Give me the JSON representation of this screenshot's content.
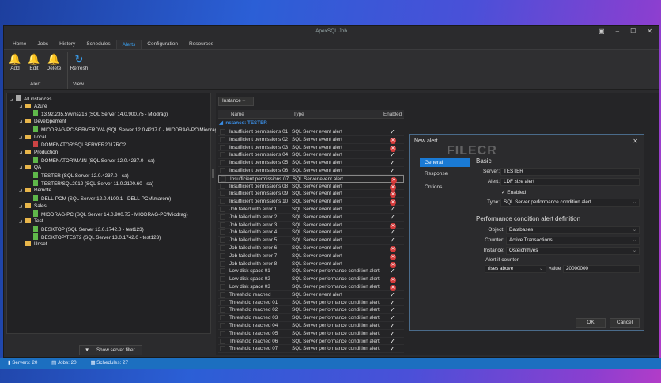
{
  "window": {
    "title": "ApexSQL Job"
  },
  "menu": [
    "Home",
    "Jobs",
    "History",
    "Schedules",
    "Alerts",
    "Configuration",
    "Resources"
  ],
  "ribbon": {
    "add": "Add",
    "edit": "Edit",
    "delete": "Delete",
    "refresh": "Refresh",
    "group_alert": "Alert",
    "group_view": "View"
  },
  "tree": [
    {
      "level": 0,
      "kind": "root",
      "label": "All instances"
    },
    {
      "level": 1,
      "kind": "folder",
      "label": "Azure"
    },
    {
      "level": 2,
      "kind": "server",
      "label": "13.92.235.5\\wins216 (SQL Server 14.0.900.75 - Miodrag)"
    },
    {
      "level": 1,
      "kind": "folder",
      "label": "Developement"
    },
    {
      "level": 2,
      "kind": "server",
      "label": "MIODRAG-PC\\SERVERDVA (SQL Server 12.0.4237.0 - MIODRAG-PC\\Miodrag)"
    },
    {
      "level": 1,
      "kind": "folder",
      "label": "Local"
    },
    {
      "level": 2,
      "kind": "server-error",
      "label": "DOMENATOR\\SQLSERVER2017RC2"
    },
    {
      "level": 1,
      "kind": "folder",
      "label": "Production"
    },
    {
      "level": 2,
      "kind": "server",
      "label": "DOMENATOR\\MAIN (SQL Server 12.0.4237.0 - sa)"
    },
    {
      "level": 1,
      "kind": "folder",
      "label": "QA"
    },
    {
      "level": 2,
      "kind": "server",
      "label": "TESTER (SQL Server 12.0.4237.0 - sa)"
    },
    {
      "level": 2,
      "kind": "server",
      "label": "TESTER\\SQL2012 (SQL Server 11.0.2100.60 - sa)"
    },
    {
      "level": 1,
      "kind": "folder",
      "label": "Remote"
    },
    {
      "level": 2,
      "kind": "server",
      "label": "DELL-PCM (SQL Server 12.0.4100.1 - DELL-PCM\\marem)"
    },
    {
      "level": 1,
      "kind": "folder",
      "label": "Sales"
    },
    {
      "level": 2,
      "kind": "server",
      "label": "MIODRAG-PC (SQL Server 14.0.900.75 - MIODRAG-PC\\Miodrag)"
    },
    {
      "level": 1,
      "kind": "folder",
      "label": "Test"
    },
    {
      "level": 2,
      "kind": "server",
      "label": "DESKTOP (SQL Server 13.0.1742.0 - test123)"
    },
    {
      "level": 2,
      "kind": "server",
      "label": "DESKTOP\\TEST2 (SQL Server 13.0.1742.0 - test123)"
    },
    {
      "level": 1,
      "kind": "folder-noexp",
      "label": "Unset"
    }
  ],
  "filter_button": "Show server filter",
  "grid": {
    "group_by": "Instance",
    "columns": [
      "Name",
      "Type",
      "Enabled"
    ],
    "group": "Instance: TESTER",
    "rows": [
      [
        "Insufficient permissions 01",
        "SQL Server event alert",
        true
      ],
      [
        "Insufficient permissions 02",
        "SQL Server event alert",
        false
      ],
      [
        "Insufficient permissions 03",
        "SQL Server event alert",
        false
      ],
      [
        "Insufficient permissions 04",
        "SQL Server event alert",
        true
      ],
      [
        "Insufficient permissions 05",
        "SQL Server event alert",
        true
      ],
      [
        "Insufficient permissions 06",
        "SQL Server event alert",
        true
      ],
      [
        "Insufficient permissions 07",
        "SQL Server event alert",
        false
      ],
      [
        "Insufficient permissions 08",
        "SQL Server event alert",
        false
      ],
      [
        "Insufficient permissions 09",
        "SQL Server event alert",
        false
      ],
      [
        "Insufficient permissions 10",
        "SQL Server event alert",
        false
      ],
      [
        "Job failed with error 1",
        "SQL Server event alert",
        true
      ],
      [
        "Job failed with error 2",
        "SQL Server event alert",
        true
      ],
      [
        "Job failed with error 3",
        "SQL Server event alert",
        false
      ],
      [
        "Job failed with error 4",
        "SQL Server event alert",
        true
      ],
      [
        "Job failed with error 5",
        "SQL Server event alert",
        true
      ],
      [
        "Job failed with error 6",
        "SQL Server event alert",
        false
      ],
      [
        "Job failed with error 7",
        "SQL Server event alert",
        false
      ],
      [
        "Job failed with error 8",
        "SQL Server event alert",
        false
      ],
      [
        "Low disk space 01",
        "SQL Server performance condition alert",
        true
      ],
      [
        "Low disk space 02",
        "SQL Server performance condition alert",
        false
      ],
      [
        "Low disk space 03",
        "SQL Server performance condition alert",
        false
      ],
      [
        "Threshold reached",
        "SQL Server event alert",
        true
      ],
      [
        "Threshold reached 01",
        "SQL Server performance condition alert",
        true
      ],
      [
        "Threshold reached 02",
        "SQL Server performance condition alert",
        true
      ],
      [
        "Threshold reached 03",
        "SQL Server performance condition alert",
        true
      ],
      [
        "Threshold reached 04",
        "SQL Server performance condition alert",
        true
      ],
      [
        "Threshold reached 05",
        "SQL Server performance condition alert",
        true
      ],
      [
        "Threshold reached 06",
        "SQL Server performance condition alert",
        true
      ],
      [
        "Threshold reached 07",
        "SQL Server performance condition alert",
        true
      ]
    ]
  },
  "dialog": {
    "title": "New alert",
    "watermark": "FILECR",
    "nav": [
      "General",
      "Response",
      "Options"
    ],
    "section": "Basic",
    "server_label": "Server:",
    "server": "TESTER",
    "alert_label": "Alert:",
    "alert": "LDF size alert",
    "enabled": "Enabled",
    "type_label": "Type:",
    "type": "SQL Server performance condition alert",
    "perf_title": "Performance condition alert definition",
    "object_label": "Object:",
    "object": "Databases",
    "counter_label": "Counter:",
    "counter": "Active Transactions",
    "instance_label": "Instance:",
    "instance": "Osteichthyes",
    "alert_if_label": "Alert if counter",
    "condition": "rises above",
    "value_label": "value",
    "value": "20000000",
    "ok": "OK",
    "cancel": "Cancel"
  },
  "status": {
    "servers": "Servers: 20",
    "jobs": "Jobs: 20",
    "schedules": "Schedules: 27"
  }
}
